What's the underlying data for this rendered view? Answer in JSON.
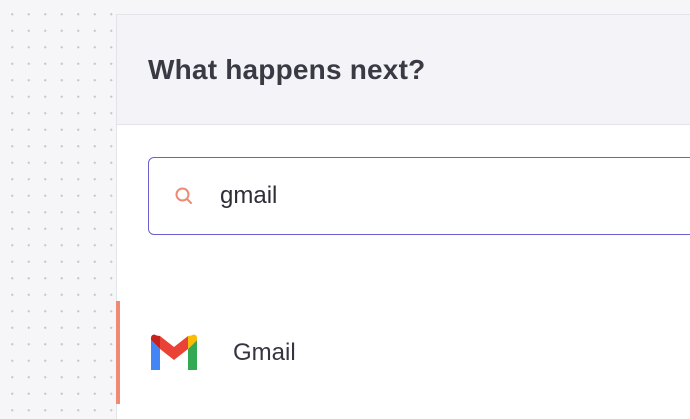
{
  "panel": {
    "title": "What happens next?"
  },
  "search": {
    "value": "gmail"
  },
  "results": [
    {
      "label": "Gmail",
      "icon": "gmail-logo"
    }
  ],
  "colors": {
    "search_border": "#6b5fd1",
    "search_icon": "#f08a73",
    "selected_accent": "#f08a73",
    "gmail_red": "#ea4335",
    "gmail_blue": "#4285f4",
    "gmail_green": "#34a853",
    "gmail_yellow": "#fbbc04",
    "gmail_dark_red": "#c5221f"
  }
}
